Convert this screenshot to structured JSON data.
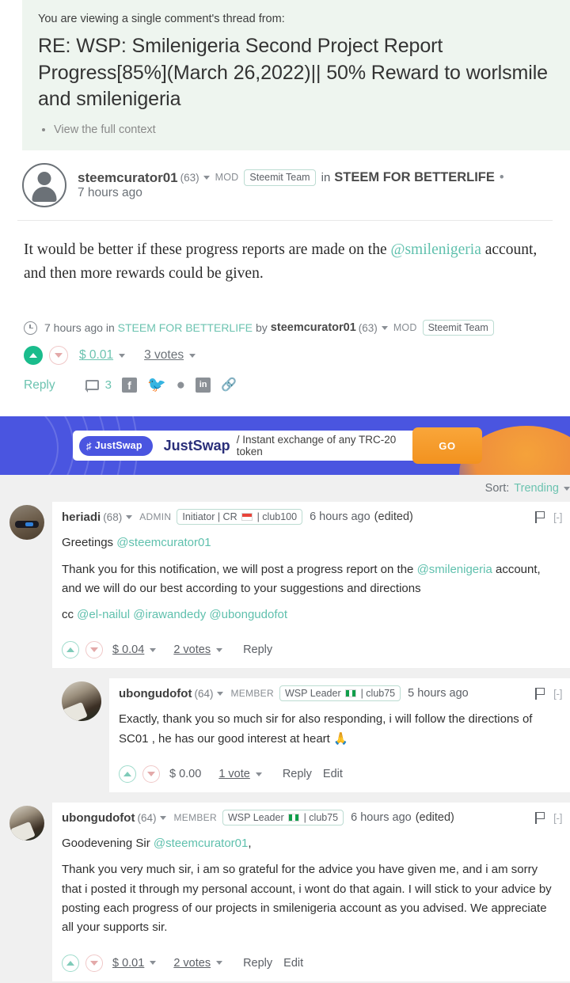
{
  "context": {
    "note": "You are viewing a single comment's thread from:",
    "title": "RE: WSP: Smilenigeria Second Project Report Progress[85%](March 26,2022)|| 50% Reward to worlsmile and smilenigeria",
    "full_context_link": "View the full context"
  },
  "post": {
    "author": "steemcurator01",
    "reputation": "(63)",
    "role": "MOD",
    "badge": "Steemit Team",
    "in_word": "in",
    "community": "STEEM FOR BETTERLIFE",
    "separator": "•",
    "timeago": "7 hours ago",
    "body_part1": "It would be better if these progress reports are made on the ",
    "body_mention": "@smilenigeria",
    "body_part2": " account, and then more rewards could be given.",
    "footer": {
      "timeago": "7 hours ago",
      "in_word": "in",
      "community": "STEEM FOR BETTERLIFE",
      "by_word": "by",
      "author": "steemcurator01",
      "reputation": "(63)",
      "role": "MOD",
      "badge": "Steemit Team",
      "payout": "$ 0.01",
      "votes": "3 votes",
      "reply": "Reply",
      "comment_count": "3",
      "social": [
        "facebook-icon",
        "twitter-icon",
        "reddit-icon",
        "linkedin-icon",
        "link-icon"
      ]
    }
  },
  "ad": {
    "chip_label": "JustSwap",
    "brand": "JustSwap",
    "tagline": "/ Instant exchange of any TRC-20 token",
    "cta": "GO",
    "bg_color": "#4a55e0",
    "cta_color": "#f2921f"
  },
  "sort": {
    "label": "Sort:",
    "value": "Trending"
  },
  "comments": [
    {
      "depth": 1,
      "author": "heriadi",
      "reputation": "(68)",
      "role": "ADMIN",
      "badge_pre": "Initiator | CR ",
      "badge_flag": "indonesia-flag",
      "badge_post": " | club100",
      "timeago": "6 hours ago",
      "edited": "(edited)",
      "collapse": "[-]",
      "paragraphs": [
        {
          "pre": "Greetings ",
          "mention": "@steemcurator01",
          "post": ""
        },
        {
          "pre": "Thank you for this notification, we will post a progress report on the ",
          "mention": "@smilenigeria",
          "post": " account, and we will do our best according to your suggestions and directions"
        },
        {
          "pre": "cc ",
          "mention": "@el-nailul @irawandedy @ubongudofot",
          "post": ""
        }
      ],
      "payout": "$ 0.04",
      "votes": "2 votes",
      "reply": "Reply",
      "edit": null
    },
    {
      "depth": 2,
      "author": "ubongudofot",
      "reputation": "(64)",
      "role": "MEMBER",
      "badge_pre": "WSP Leader ",
      "badge_flag": "nigeria-flag",
      "badge_post": " | club75",
      "timeago": "5 hours ago",
      "edited": null,
      "collapse": "[-]",
      "paragraphs": [
        {
          "pre": "Exactly, thank you so much sir for also responding, i will follow the directions of SC01 , he has our good interest at heart 🙏",
          "mention": "",
          "post": ""
        }
      ],
      "payout": "$ 0.00",
      "votes": "1 vote",
      "reply": "Reply",
      "edit": "Edit"
    },
    {
      "depth": 1,
      "author": "ubongudofot",
      "reputation": "(64)",
      "role": "MEMBER",
      "badge_pre": "WSP Leader ",
      "badge_flag": "nigeria-flag",
      "badge_post": " | club75",
      "timeago": "6 hours ago",
      "edited": "(edited)",
      "collapse": "[-]",
      "paragraphs": [
        {
          "pre": "Goodevening Sir ",
          "mention": "@steemcurator01",
          "post": ","
        },
        {
          "pre": "Thank you very much sir, i am so grateful for the advice you have given me, and i am sorry that i posted it through my personal account, i wont do that again. I will stick to your advice by posting each progress of our projects in smilenigeria account as you advised. We appreciate all your supports sir.",
          "mention": "",
          "post": ""
        }
      ],
      "payout": "$ 0.01",
      "votes": "2 votes",
      "reply": "Reply",
      "edit": "Edit"
    }
  ],
  "colors": {
    "accent_green": "#6cc3b0",
    "upvote_filled": "#1abc8c",
    "context_bg": "#eef5ef",
    "page_bg": "#f0f0f0"
  }
}
